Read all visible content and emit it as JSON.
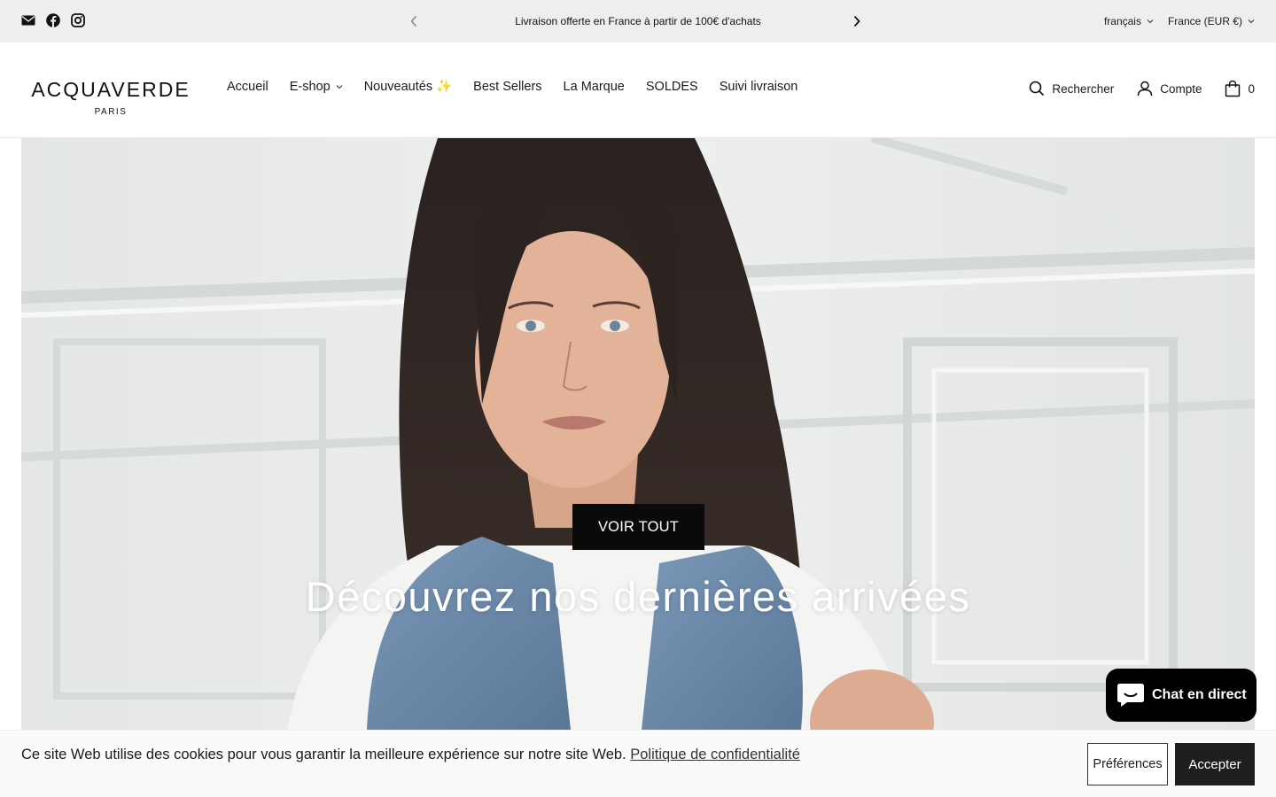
{
  "topbar": {
    "announcement": "Livraison offerte en France à partir de 100€ d'achats",
    "language": "français",
    "currency": "France (EUR €)",
    "social_icons": [
      "mail-icon",
      "facebook-icon",
      "instagram-icon"
    ]
  },
  "header": {
    "logo_text": "ACQUAVERDE",
    "logo_sub": "PARIS",
    "nav": [
      "Accueil",
      "E-shop",
      "Nouveautés ✨",
      "Best Sellers",
      "La Marque",
      "SOLDES",
      "Suivi livraison"
    ],
    "search_label": "Rechercher",
    "account_label": "Compte",
    "cart_count": "0"
  },
  "hero": {
    "title": "Découvrez nos dernières arrivées",
    "button_label": "VOIR TOUT"
  },
  "chat": {
    "label": "Chat en direct"
  },
  "cookie": {
    "message": "Ce site Web utilise des cookies pour vous garantir la meilleure expérience sur notre site Web.",
    "link": "Politique de confidentialité",
    "preferences_label": "Préférences",
    "accept_label": "Accepter"
  },
  "colors": {
    "topbar_bg": "#eeeeee",
    "button_bg": "#0a0a0a",
    "chat_bg": "#000000"
  }
}
